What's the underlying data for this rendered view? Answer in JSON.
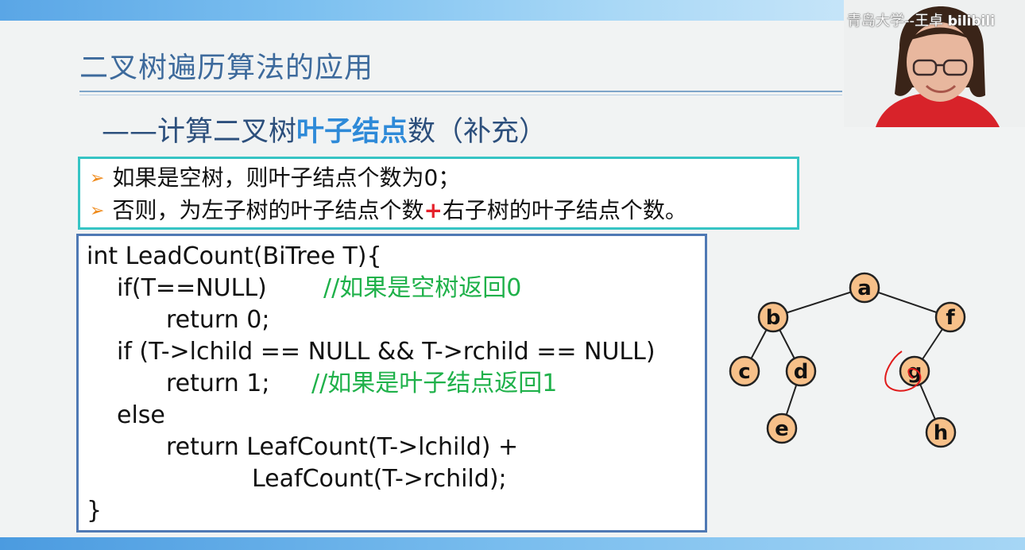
{
  "slide": {
    "title": "二叉树遍历算法的应用",
    "subtitle_prefix": "——计算二叉树",
    "subtitle_highlight": "叶子结点",
    "subtitle_suffix": "数（补充）"
  },
  "rules": {
    "bullet_glyph": "➢",
    "r1": "如果是空树，则叶子结点个数为0；",
    "r2_a": "否则，为左子树的叶子结点个数",
    "r2_plus": "+",
    "r2_b": "右子树的叶子结点个数。"
  },
  "code": {
    "l1": "int LeadCount(BiTree T){",
    "l2_code": "if(T==NULL)",
    "l2_cmt": "//如果是空树返回0",
    "l3": "return 0;",
    "l4": "if (T->lchild == NULL && T->rchild == NULL)",
    "l5_code": "return 1;",
    "l5_cmt": "//如果是叶子结点返回1",
    "l6": "else",
    "l7": "return LeafCount(T->lchild) +",
    "l8": "LeafCount(T->rchild);",
    "l9": "}"
  },
  "tree": {
    "nodes": [
      "a",
      "b",
      "f",
      "c",
      "d",
      "g",
      "e",
      "h"
    ],
    "node_fill": "#f7c089",
    "node_stroke": "#222222",
    "edge_color": "#222222",
    "annotation_color": "#e01b1b"
  },
  "overlay": {
    "watermark": "青岛大学--王卓",
    "watermark_logo": "bilibili"
  },
  "colors": {
    "title": "#3d6a9c",
    "highlight": "#2e8ad8",
    "comment": "#1fb14a",
    "plus": "#e5212b",
    "bullet": "#ef8a1a",
    "rules_border": "#36c4c4",
    "code_border": "#4f79b4"
  }
}
